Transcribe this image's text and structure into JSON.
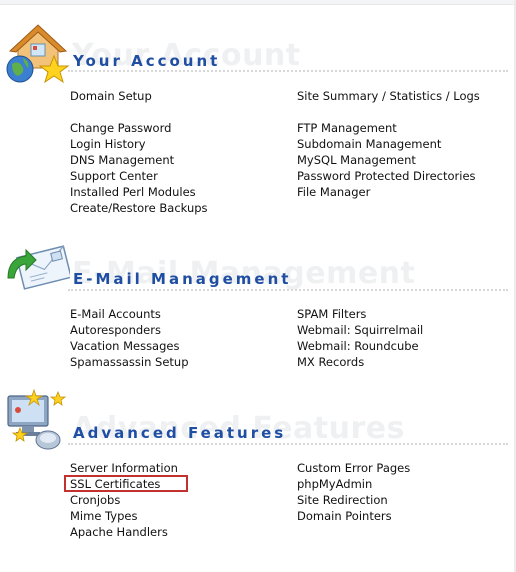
{
  "sections": [
    {
      "title": "Your Account",
      "left_links": [
        "Domain Setup",
        "Change Password",
        "Login History",
        "DNS Management",
        "Support Center",
        "Installed Perl Modules",
        "Create/Restore Backups"
      ],
      "right_links": [
        "Site Summary / Statistics / Logs",
        "FTP Management",
        "Subdomain Management",
        "MySQL Management",
        "Password Protected Directories",
        "File Manager"
      ]
    },
    {
      "title": "E-Mail Management",
      "left_links": [
        "E-Mail Accounts",
        "Autoresponders",
        "Vacation Messages",
        "Spamassassin Setup"
      ],
      "right_links": [
        "SPAM Filters",
        "Webmail: Squirrelmail",
        "Webmail: Roundcube",
        "MX Records"
      ]
    },
    {
      "title": "Advanced Features",
      "left_links": [
        "Server Information",
        "SSL Certificates",
        "Cronjobs",
        "Mime Types",
        "Apache Handlers"
      ],
      "right_links": [
        "Custom Error Pages",
        "phpMyAdmin",
        "Site Redirection",
        "Domain Pointers"
      ]
    }
  ],
  "highlighted_item": "SSL Certificates",
  "colors": {
    "title": "#1f4ea3",
    "highlight_border": "#c3312f"
  },
  "icons": [
    "house-globe-star-icon",
    "email-envelope-arrow-icon",
    "computer-monitor-stars-icon"
  ]
}
